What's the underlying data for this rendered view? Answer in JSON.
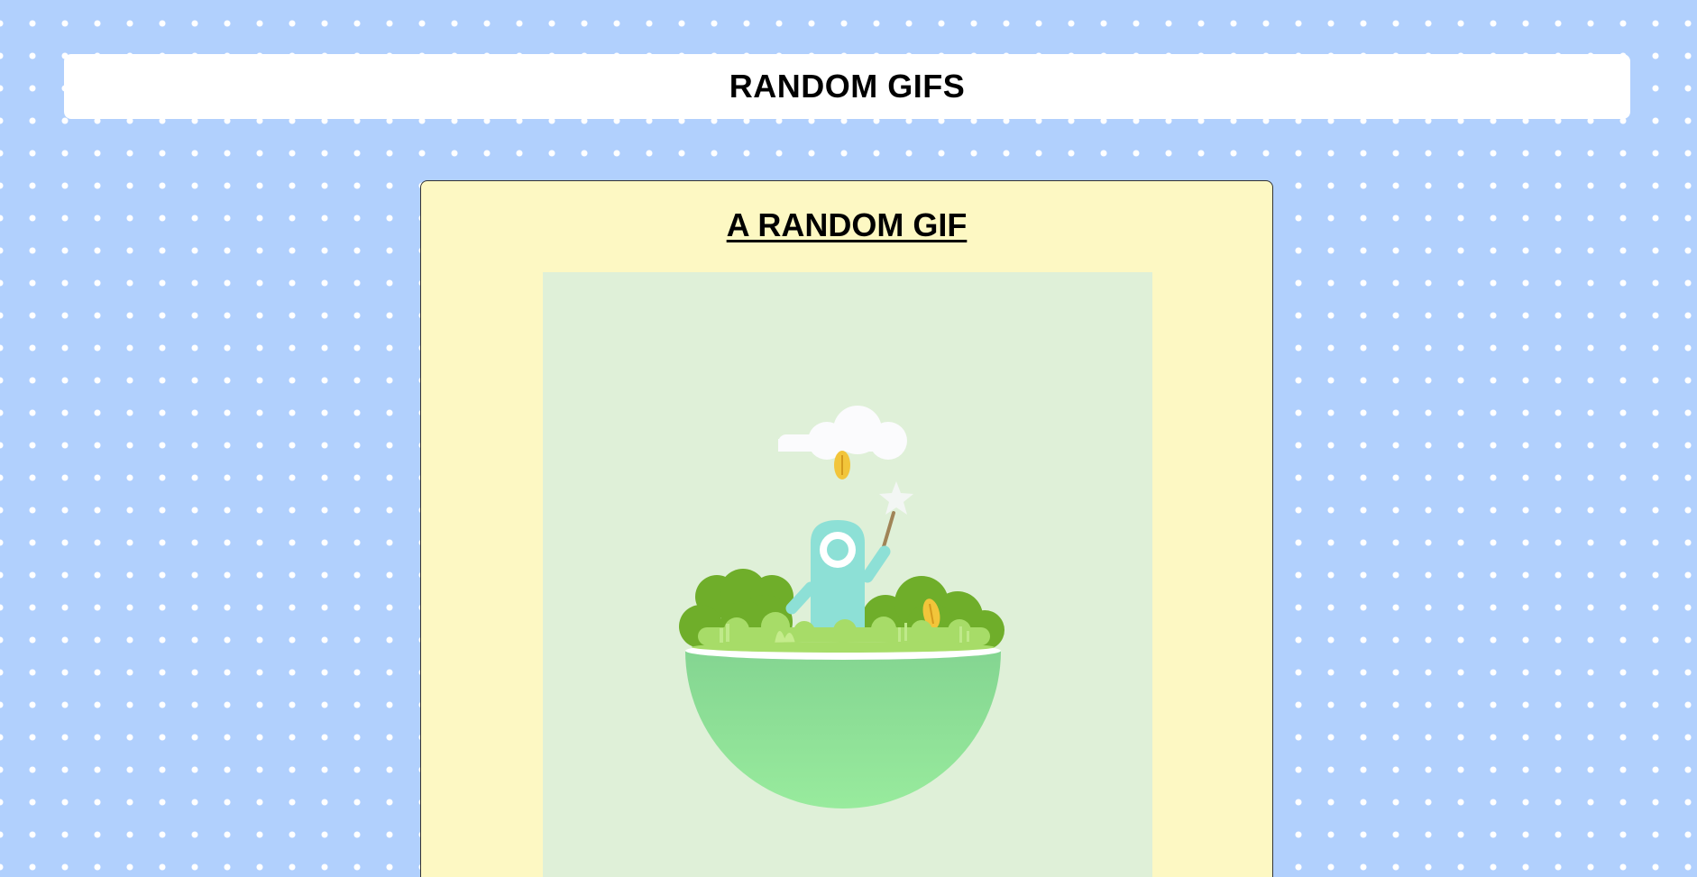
{
  "header": {
    "title": "RANDOM GIFS"
  },
  "card": {
    "title": "A RANDOM GIF",
    "image": {
      "icon": "plant-bowl-character-illustration",
      "background_color": "#dff0d8"
    }
  },
  "colors": {
    "page_background": "#b1d0fd",
    "header_background": "#ffffff",
    "card_background": "#fdf8c3"
  }
}
